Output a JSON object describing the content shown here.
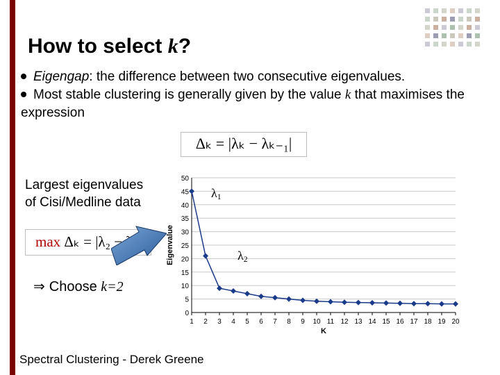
{
  "title_prefix": "How to select ",
  "title_var": "k",
  "title_suffix": "?",
  "bullet1_a": "Eigengap",
  "bullet1_b": ": the difference between two consecutive eigenvalues.",
  "bullet2_a": "Most stable clustering is generally given by the value ",
  "bullet2_k": "k",
  "bullet2_b": " that maximises the expression",
  "eq1": "Δₖ = |λₖ − λₖ₋₁|",
  "largest_l1": "Largest eigenvalues",
  "largest_l2": "of Cisi/Medline data",
  "eq2_max": "max ",
  "eq2_body": "Δₖ = |λ₂ − λ₁|",
  "choose_a": "Choose ",
  "choose_b": "k=2",
  "lambda1": "λ",
  "lambda1_sub": "1",
  "lambda2": "λ",
  "lambda2_sub": "2",
  "footer": "Spectral Clustering - Derek Greene",
  "chart_data": {
    "type": "line",
    "title": "",
    "xlabel": "K",
    "ylabel": "Eigenvalue",
    "xlim": [
      1,
      20
    ],
    "ylim": [
      0,
      50
    ],
    "y_ticks": [
      0,
      5,
      10,
      15,
      20,
      25,
      30,
      35,
      40,
      45,
      50
    ],
    "x_ticks": [
      1,
      2,
      3,
      4,
      5,
      6,
      7,
      8,
      9,
      10,
      11,
      12,
      13,
      14,
      15,
      16,
      17,
      18,
      19,
      20
    ],
    "values": [
      45,
      21,
      9,
      8,
      7,
      6,
      5.5,
      5,
      4.5,
      4.2,
      4,
      3.8,
      3.7,
      3.6,
      3.5,
      3.4,
      3.3,
      3.3,
      3.2,
      3.2
    ]
  },
  "deco_rows": 5,
  "deco_cols": 7
}
